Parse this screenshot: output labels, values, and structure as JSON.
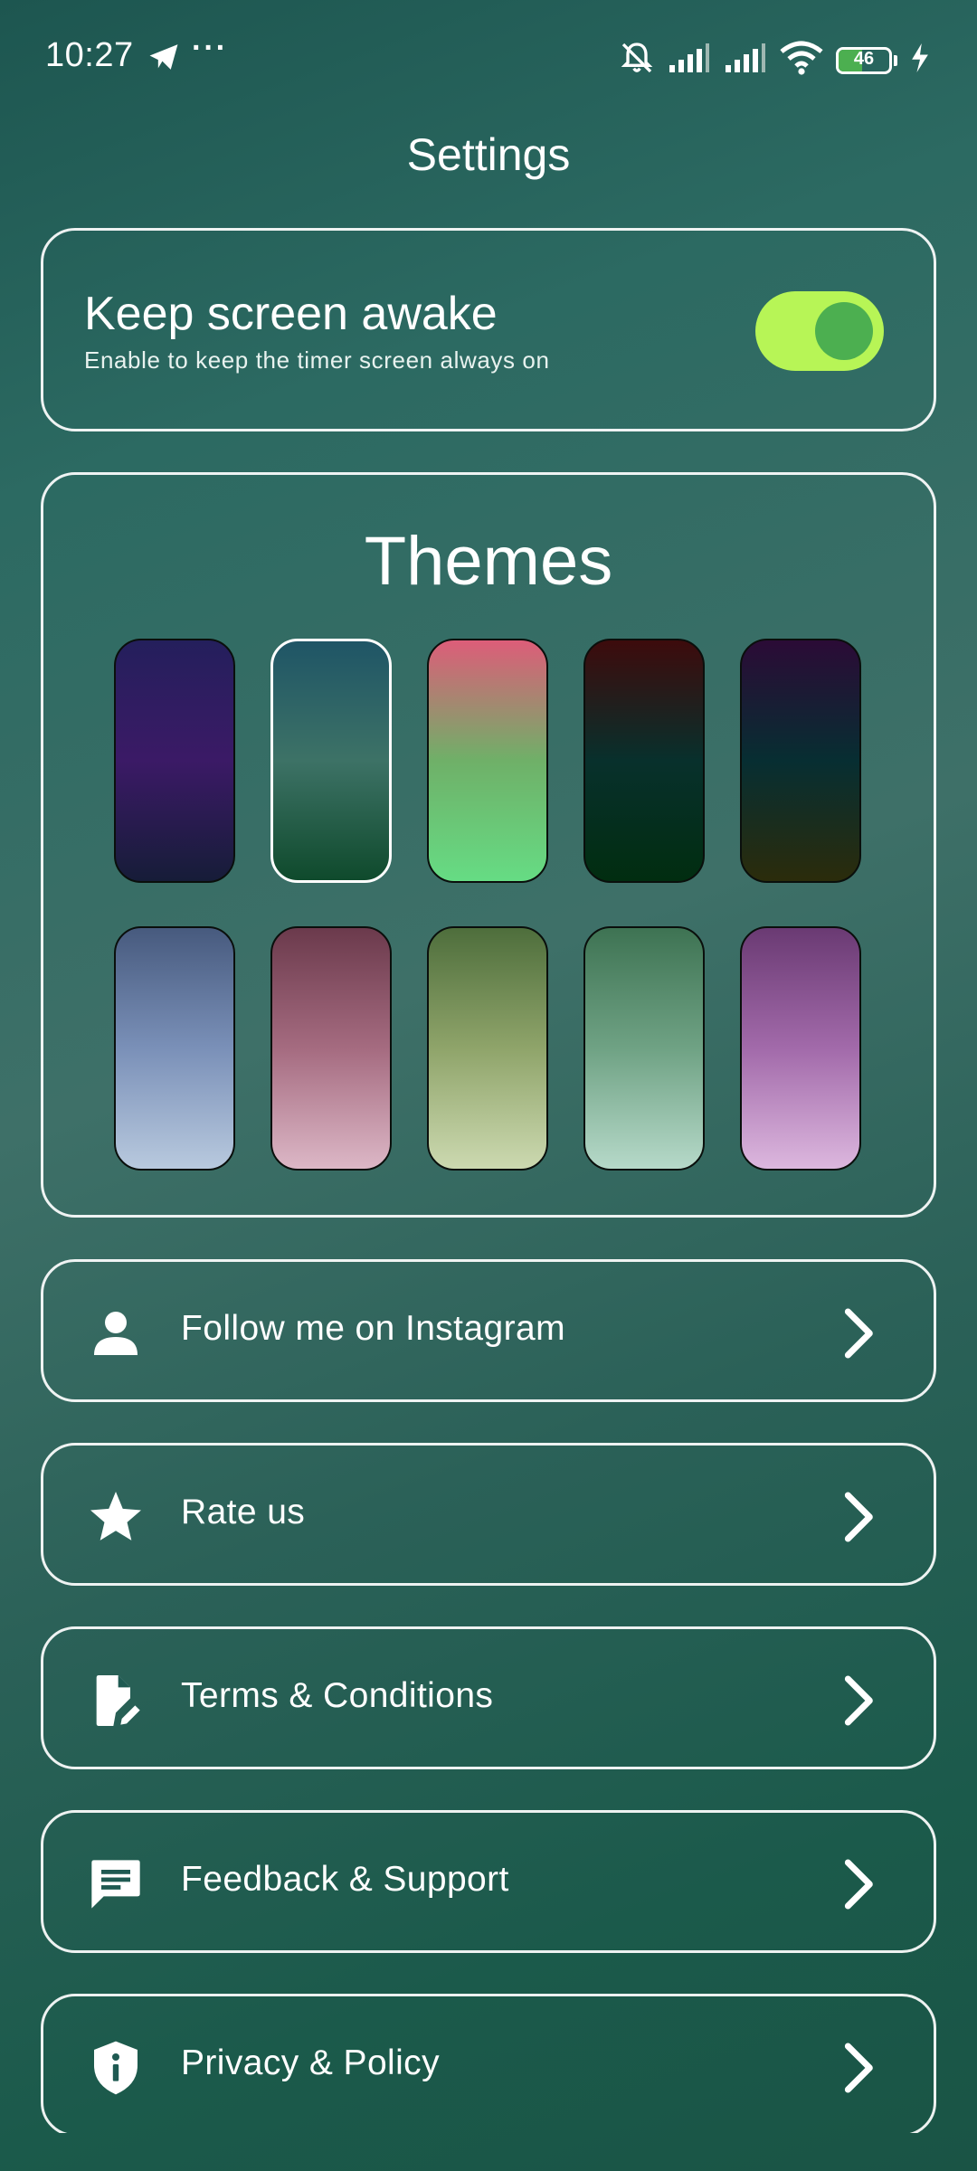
{
  "status_bar": {
    "time": "10:27",
    "more": "···",
    "battery_level": "46",
    "battery_fraction": 0.46
  },
  "header": {
    "title": "Settings"
  },
  "keep_awake": {
    "title": "Keep screen awake",
    "subtitle": "Enable to keep the timer screen always on",
    "enabled": true
  },
  "themes": {
    "title": "Themes",
    "selected_index": 1,
    "swatches": [
      {
        "name": "indigo-night",
        "colors": [
          "#241f5c",
          "#3b1a66",
          "#161c38"
        ]
      },
      {
        "name": "teal-forest",
        "colors": [
          "#1f5566",
          "#3d7266",
          "#0f4a2c"
        ]
      },
      {
        "name": "rose-mint",
        "colors": [
          "#dd5d79",
          "#6fb068",
          "#66dc84"
        ]
      },
      {
        "name": "crimson-forest",
        "colors": [
          "#3d0b0c",
          "#08302c",
          "#012d10"
        ]
      },
      {
        "name": "plum-olive",
        "colors": [
          "#2b0b36",
          "#072e32",
          "#2b2c0b"
        ]
      },
      {
        "name": "slate-sky",
        "colors": [
          "#475a7e",
          "#7a90b8",
          "#b8c9de"
        ]
      },
      {
        "name": "wine-blush",
        "colors": [
          "#6b3a4c",
          "#a56b80",
          "#dcb7c6"
        ]
      },
      {
        "name": "moss-sage",
        "colors": [
          "#4e6e3c",
          "#8fa46a",
          "#ccd9b0"
        ]
      },
      {
        "name": "fern-mist",
        "colors": [
          "#3e7353",
          "#6fa284",
          "#b6d9c9"
        ]
      },
      {
        "name": "orchid",
        "colors": [
          "#6a3a73",
          "#a26aaa",
          "#dcb7de"
        ]
      }
    ]
  },
  "menu": [
    {
      "label": "Follow me on Instagram",
      "icon": "person-icon"
    },
    {
      "label": "Rate us",
      "icon": "star-icon"
    },
    {
      "label": "Terms & Conditions",
      "icon": "document-edit-icon"
    },
    {
      "label": "Feedback & Support",
      "icon": "chat-icon"
    },
    {
      "label": "Privacy & Policy",
      "icon": "shield-info-icon"
    }
  ],
  "colors": {
    "accent_toggle_track": "#b7f556",
    "accent_toggle_knob": "#4caf50"
  }
}
